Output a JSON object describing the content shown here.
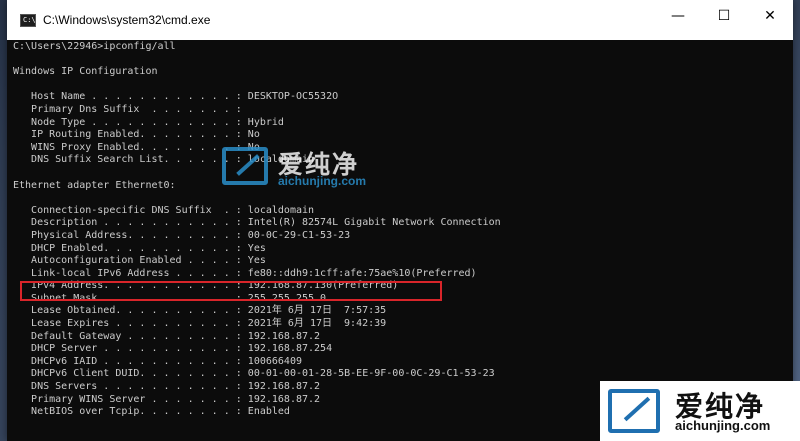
{
  "window": {
    "title": "C:\\Windows\\system32\\cmd.exe",
    "icon_text": "C:\\",
    "minimize_glyph": "—",
    "maximize_glyph": "☐",
    "close_glyph": "✕"
  },
  "console": {
    "lines": [
      "C:\\Users\\22946>ipconfig/all",
      "",
      "Windows IP Configuration",
      "",
      "   Host Name . . . . . . . . . . . . : DESKTOP-OC5532O",
      "   Primary Dns Suffix  . . . . . . . :",
      "   Node Type . . . . . . . . . . . . : Hybrid",
      "   IP Routing Enabled. . . . . . . . : No",
      "   WINS Proxy Enabled. . . . . . . . : No",
      "   DNS Suffix Search List. . . . . . : localdomain",
      "",
      "Ethernet adapter Ethernet0:",
      "",
      "   Connection-specific DNS Suffix  . : localdomain",
      "   Description . . . . . . . . . . . : Intel(R) 82574L Gigabit Network Connection",
      "   Physical Address. . . . . . . . . : 00-0C-29-C1-53-23",
      "   DHCP Enabled. . . . . . . . . . . : Yes",
      "   Autoconfiguration Enabled . . . . : Yes",
      "   Link-local IPv6 Address . . . . . : fe80::ddh9:1cff:afe:75ae%10(Preferred)",
      "   IPv4 Address. . . . . . . . . . . : 192.168.87.130(Preferred)",
      "   Subnet Mask . . . . . . . . . . . : 255.255.255.0",
      "   Lease Obtained. . . . . . . . . . : 2021年 6月 17日  7:57:35",
      "   Lease Expires . . . . . . . . . . : 2021年 6月 17日  9:42:39",
      "   Default Gateway . . . . . . . . . : 192.168.87.2",
      "   DHCP Server . . . . . . . . . . . : 192.168.87.254",
      "   DHCPv6 IAID . . . . . . . . . . . : 100666409",
      "   DHCPv6 Client DUID. . . . . . . . : 00-01-00-01-28-5B-EE-9F-00-0C-29-C1-53-23",
      "   DNS Servers . . . . . . . . . . . : 192.168.87.2",
      "   Primary WINS Server . . . . . . . : 192.168.87.2",
      "   NetBIOS over Tcpip. . . . . . . . : Enabled"
    ]
  },
  "watermark": {
    "cn": "爱纯净",
    "en": "aichunjing.com"
  },
  "colors": {
    "console_bg": "#0c0c0c",
    "console_fg": "#cccccc",
    "highlight_border": "#d9252a",
    "watermark_blue": "#2a8ec9"
  }
}
